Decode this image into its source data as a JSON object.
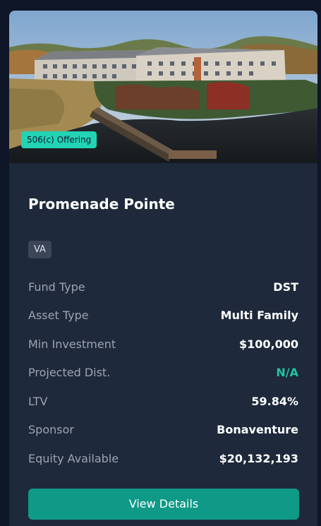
{
  "card": {
    "badge": "506(c) Offering",
    "title": "Promenade Pointe",
    "state": "VA",
    "details": [
      {
        "label": "Fund Type",
        "value": "DST"
      },
      {
        "label": "Asset Type",
        "value": "Multi Family"
      },
      {
        "label": "Min Investment",
        "value": "$100,000"
      },
      {
        "label": "Projected Dist.",
        "value": "N/A"
      },
      {
        "label": "LTV",
        "value": "59.84%"
      },
      {
        "label": "Sponsor",
        "value": "Bonaventure"
      },
      {
        "label": "Equity Available",
        "value": "$20,132,193"
      }
    ],
    "button_label": "View Details"
  },
  "colors": {
    "page_bg": "#0f1628",
    "card_bg": "#1e293b",
    "badge_bg": "#22d3b4",
    "accent": "#22c3a6",
    "button_bg": "#0f9987"
  }
}
